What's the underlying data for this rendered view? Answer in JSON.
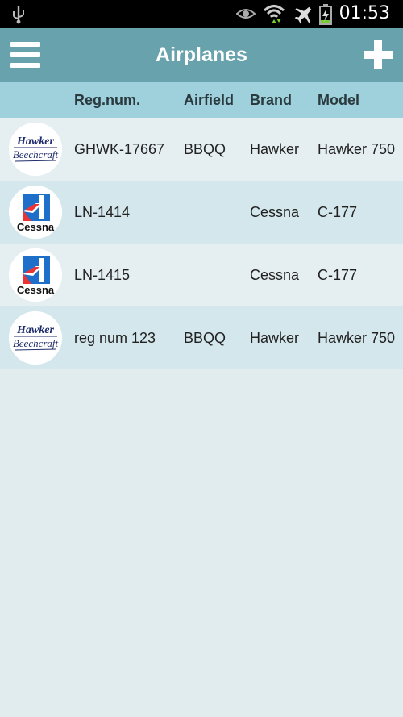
{
  "app": {
    "title": "Airplanes",
    "clock": "01:53"
  },
  "colors": {
    "appbar": "#67a2ad",
    "header": "#9ed1db",
    "row_light": "#e5eff2",
    "row_alt": "#d4e7ec",
    "background": "#e1ecef"
  },
  "table": {
    "headers": {
      "reg": "Reg.num.",
      "airfield": "Airfield",
      "brand": "Brand",
      "model": "Model"
    },
    "rows": [
      {
        "logo": "hawker-beechcraft-logo",
        "logo_line1": "Hawker",
        "logo_line2": "Beechcraft",
        "reg": "GHWK-17667",
        "airfield": "BBQQ",
        "brand": "Hawker",
        "model": "Hawker 750"
      },
      {
        "logo": "cessna-logo",
        "logo_text": "Cessna",
        "reg": "LN-1414",
        "airfield": "",
        "brand": "Cessna",
        "model": "C-177"
      },
      {
        "logo": "cessna-logo",
        "logo_text": "Cessna",
        "reg": "LN-1415",
        "airfield": "",
        "brand": "Cessna",
        "model": "C-177"
      },
      {
        "logo": "hawker-beechcraft-logo",
        "logo_line1": "Hawker",
        "logo_line2": "Beechcraft",
        "reg": "reg num 123",
        "airfield": "BBQQ",
        "brand": "Hawker",
        "model": "Hawker 750"
      }
    ]
  }
}
